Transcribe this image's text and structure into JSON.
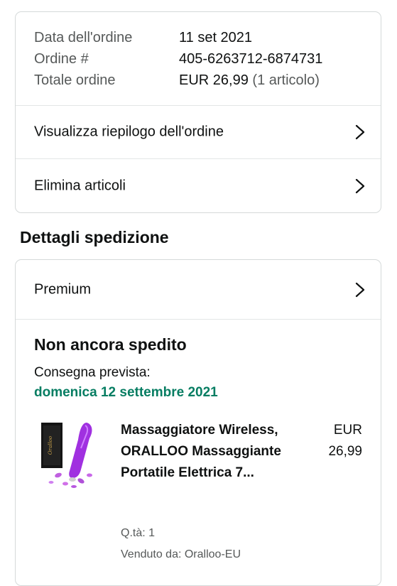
{
  "order_info": {
    "date_label": "Data dell'ordine",
    "date_value": "11 set 2021",
    "number_label": "Ordine #",
    "number_value": "405-6263712-6874731",
    "total_label": "Totale ordine",
    "total_value": "EUR 26,99",
    "total_items": "(1 articolo)"
  },
  "actions": {
    "summary_label": "Visualizza riepilogo dell'ordine",
    "delete_label": "Elimina articoli"
  },
  "shipping": {
    "section_title": "Dettagli spedizione",
    "method_label": "Premium",
    "status": "Non ancora spedito",
    "delivery_label": "Consegna prevista:",
    "delivery_date": "domenica 12 settembre 2021"
  },
  "product": {
    "title": "Massaggiatore Wireless, ORALLOO Massaggiante Portatile Elettrica 7...",
    "price_currency": "EUR",
    "price_value": "26,99",
    "qty": "Q.tà: 1",
    "seller": "Venduto da: Oralloo-EU",
    "box_brand_text": "Oralloo"
  },
  "colors": {
    "accent_green": "#067d62",
    "text": "#0f1111",
    "muted": "#565959",
    "border": "#d5d9d9",
    "product_purple": "#a030e0"
  }
}
